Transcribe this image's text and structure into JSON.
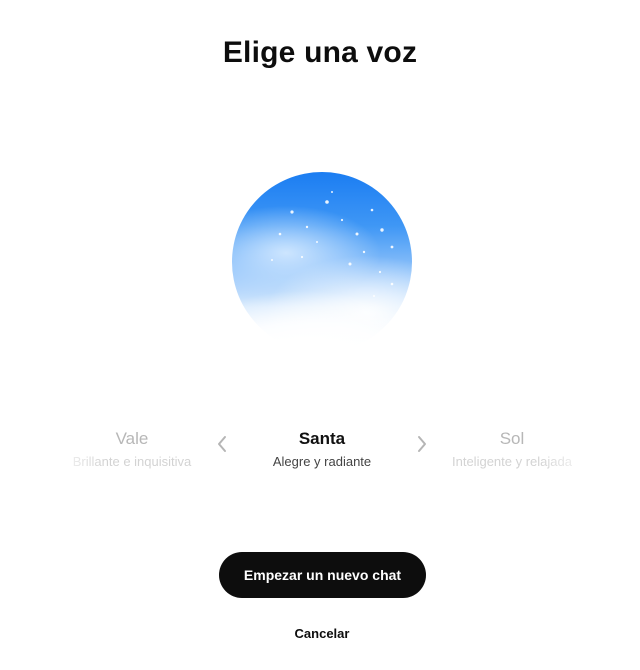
{
  "page": {
    "title": "Elige una voz"
  },
  "voices": {
    "previous": {
      "name": "Vale",
      "description": "Brillante e inquisitiva"
    },
    "selected": {
      "name": "Santa",
      "description": "Alegre y radiante"
    },
    "next": {
      "name": "Sol",
      "description": "Inteligente y relajada"
    }
  },
  "icons": {
    "prev": "chevron-left-icon",
    "next": "chevron-right-icon",
    "orb": "voice-orb"
  },
  "actions": {
    "start_label": "Empezar un nuevo chat",
    "cancel_label": "Cancelar"
  },
  "colors": {
    "primary_button": "#0d0d0d",
    "orb_blue": "#1b7df2",
    "text": "#111111",
    "muted": "#b7b7b7"
  }
}
